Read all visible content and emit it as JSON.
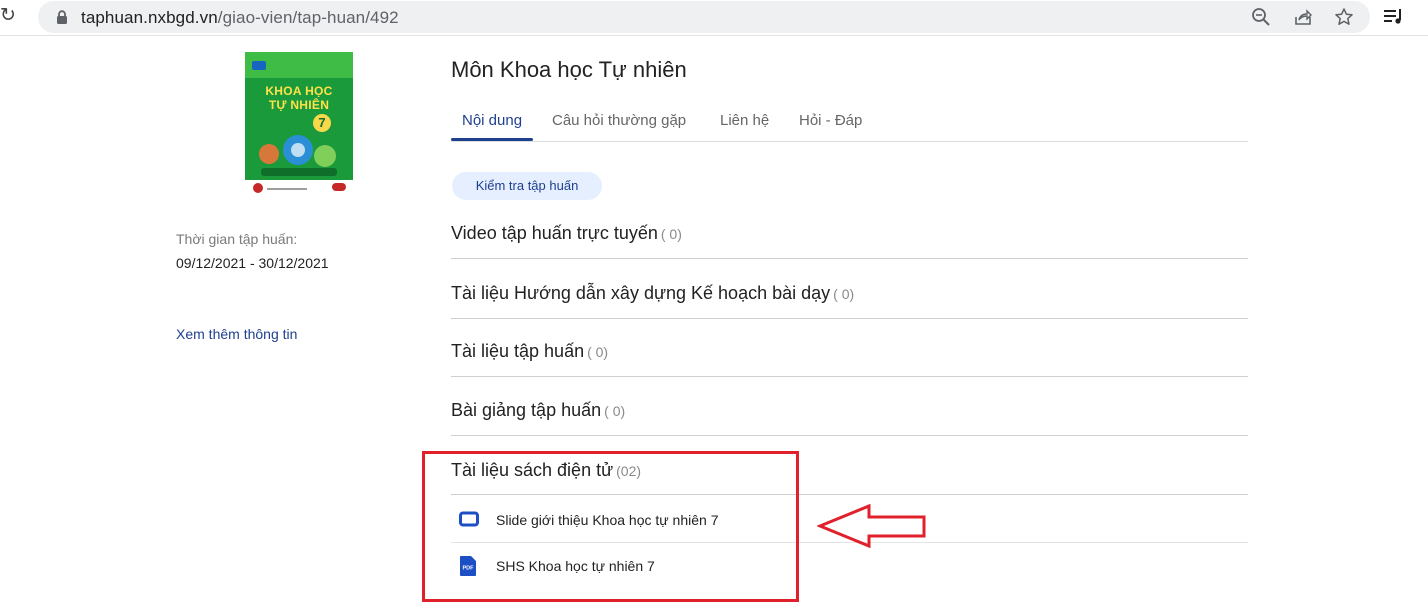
{
  "browser": {
    "url_host": "taphuan.nxbgd.vn",
    "url_path": "/giao-vien/tap-huan/492",
    "icons": [
      "reload-icon",
      "lock-icon",
      "zoom-icon",
      "share-icon",
      "star-icon",
      "playlist-icon"
    ]
  },
  "book": {
    "cover_title_line1": "KHOA HỌC",
    "cover_title_line2": "TỰ NHIÊN",
    "cover_grade": "7"
  },
  "sidebar": {
    "time_label": "Thời gian tập huấn:",
    "time_value": "09/12/2021 - 30/12/2021",
    "more_link": "Xem thêm thông tin"
  },
  "main": {
    "title": "Môn Khoa học Tự nhiên",
    "tabs": [
      {
        "label": "Nội dung",
        "active": true
      },
      {
        "label": "Câu hỏi thường gặp",
        "active": false
      },
      {
        "label": "Liên hệ",
        "active": false
      },
      {
        "label": "Hỏi - Đáp",
        "active": false
      }
    ],
    "check_button": "Kiểm tra tập huấn",
    "sections": [
      {
        "title": "Video tập huấn trực tuyến",
        "count": "( 0)"
      },
      {
        "title": "Tài liệu Hướng dẫn xây dựng Kế hoạch bài dạy",
        "count": "( 0)"
      },
      {
        "title": "Tài liệu tập huấn",
        "count": "( 0)"
      },
      {
        "title": "Bài giảng tập huấn",
        "count": "( 0)"
      },
      {
        "title": "Tài liệu sách điện tử",
        "count": "(02)"
      }
    ],
    "documents": [
      {
        "label": "Slide giới thiệu Khoa học tự nhiên 7",
        "icon": "slide-icon"
      },
      {
        "label": "SHS Khoa học tự nhiên 7",
        "icon": "pdf-icon",
        "icon_text": "PDF"
      }
    ]
  },
  "colors": {
    "accent": "#1f3f8f",
    "pill_bg": "#e5efff",
    "annotation_red": "#e0202a",
    "doc_icon_blue": "#1c4fc4"
  }
}
